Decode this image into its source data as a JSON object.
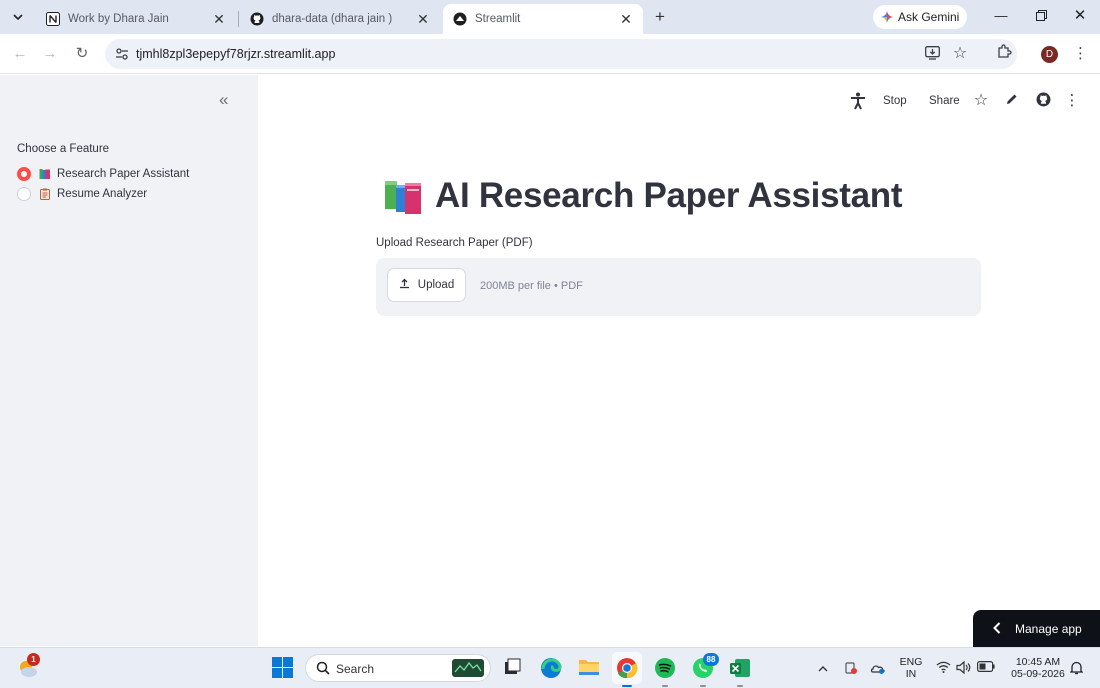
{
  "browser": {
    "tabs": [
      {
        "title": "Work by Dhara Jain",
        "icon": "notion-icon"
      },
      {
        "title": "dhara-data (dhara jain )",
        "icon": "github-icon"
      },
      {
        "title": "Streamlit",
        "icon": "streamlit-icon",
        "active": true
      }
    ],
    "gemini_label": "Ask Gemini",
    "url": "tjmhl8zpl3epepyf78rjzr.streamlit.app",
    "profile_initial": "D"
  },
  "sidebar": {
    "radio_label": "Choose a Feature",
    "options": [
      {
        "label": "Research Paper Assistant",
        "icon": "books-icon",
        "selected": true
      },
      {
        "label": "Resume Analyzer",
        "icon": "clipboard-icon",
        "selected": false
      }
    ]
  },
  "toolbar": {
    "stop_label": "Stop",
    "share_label": "Share"
  },
  "main": {
    "title": "AI Research Paper Assistant",
    "uploader_label": "Upload Research Paper (PDF)",
    "upload_button": "Upload",
    "upload_limit": "200MB per file • PDF"
  },
  "manage_app_label": "Manage app",
  "taskbar": {
    "weather_badge": "1",
    "search_label": "Search",
    "whatsapp_badge": "88",
    "language": "ENG",
    "region": "IN",
    "time": "10:45 AM",
    "date": "05-09-2026"
  },
  "colors": {
    "accent": "#ff4b4b",
    "sidebar_bg": "#f0f2f6",
    "text": "#31333f",
    "manage_bg": "#0e1117"
  }
}
